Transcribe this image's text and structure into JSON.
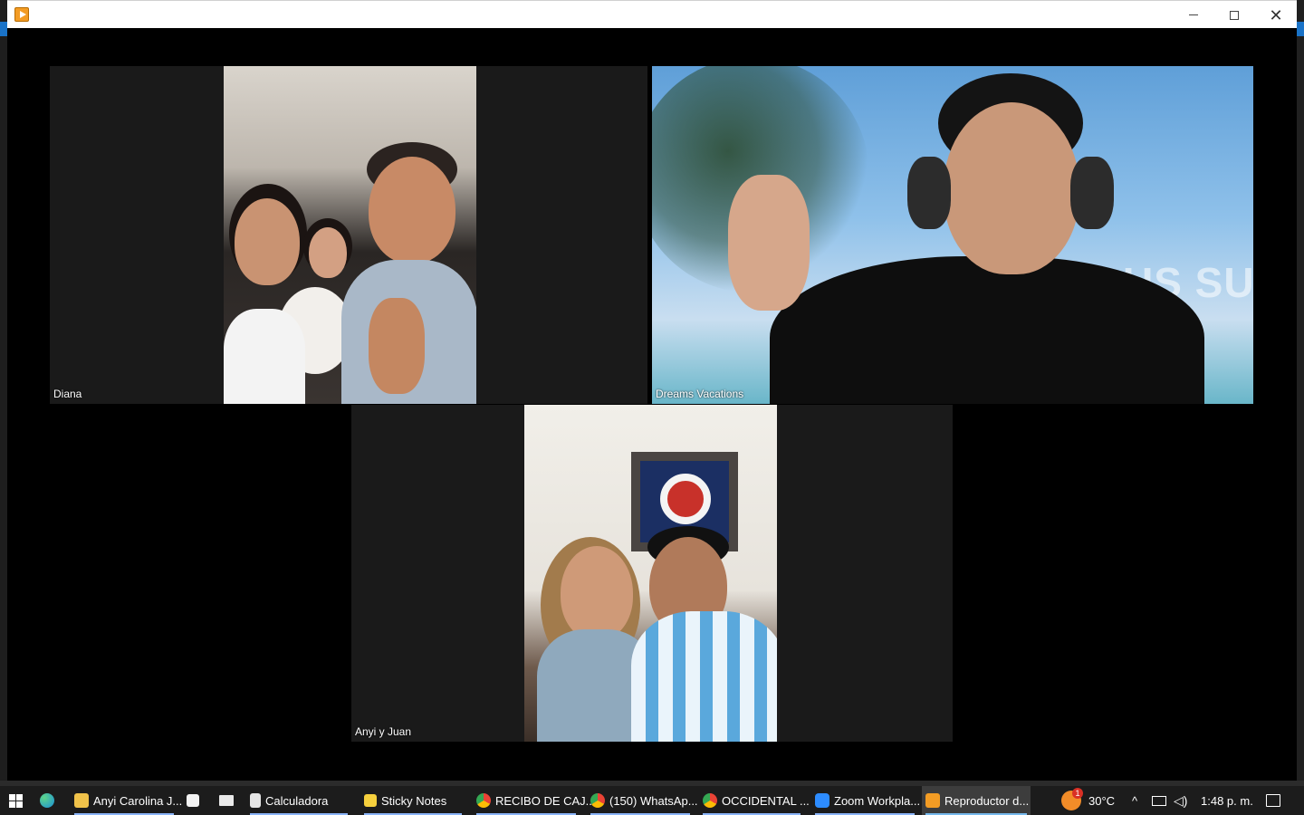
{
  "window": {
    "title": "",
    "app_icon": "media-player-icon"
  },
  "participants": [
    {
      "name": "Diana"
    },
    {
      "name": "Dreams Vacations",
      "background_text": "US SUEÑ\nSTI"
    },
    {
      "name": "Anyi y Juan"
    }
  ],
  "taskbar": {
    "items": [
      {
        "label": "Anyi Carolina J...",
        "icon": "folder-icon",
        "color": "#f0c24a"
      },
      {
        "label": "Calculadora",
        "icon": "calculator-icon",
        "color": "#e6e6e6"
      },
      {
        "label": "Sticky Notes",
        "icon": "sticky-notes-icon",
        "color": "#f6d03d"
      },
      {
        "label": "RECIBO DE CAJ...",
        "icon": "chrome-icon",
        "color": "#4285f4"
      },
      {
        "label": "(150) WhatsAp...",
        "icon": "chrome-icon",
        "color": "#4285f4"
      },
      {
        "label": "OCCIDENTAL ...",
        "icon": "chrome-icon",
        "color": "#4285f4"
      },
      {
        "label": "Zoom Workpla...",
        "icon": "zoom-icon",
        "color": "#2d8cff"
      },
      {
        "label": "Reproductor d...",
        "icon": "media-player-icon",
        "color": "#f39c24"
      }
    ],
    "weather": {
      "temp": "30°C",
      "badge": "1"
    },
    "clock": "1:48 p. m."
  }
}
